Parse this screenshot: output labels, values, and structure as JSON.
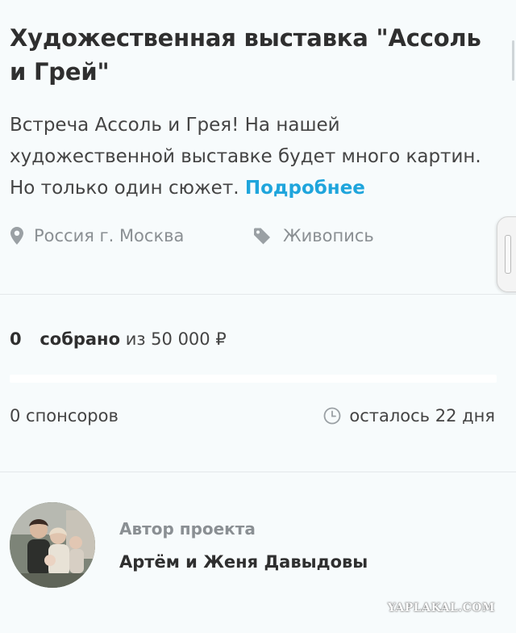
{
  "project": {
    "title": "Художественная выставка \"Ассоль и Грей\"",
    "description": "Встреча Ассоль и Грея! На нашей художественной выставке будет много картин. Но только один сюжет.",
    "more_link": "Подробнее",
    "location": "Россия г. Москва",
    "category": "Живопись"
  },
  "funding": {
    "collected_amount": "0",
    "collected_label": "собрано",
    "goal_text": "из 50 000 ₽",
    "progress_percent": 0,
    "sponsors": "0 спонсоров",
    "remaining": "осталось 22 дня"
  },
  "author": {
    "label": "Автор проекта",
    "name": "Артём и Женя Давыдовы"
  },
  "watermark": "YAPLAKAL.COM",
  "icons": {
    "location": "map-pin-icon",
    "category": "tag-icon",
    "time": "clock-icon"
  },
  "colors": {
    "accent": "#1fa5dc",
    "background": "#f7fbfc",
    "muted_text": "#8a8f93"
  }
}
